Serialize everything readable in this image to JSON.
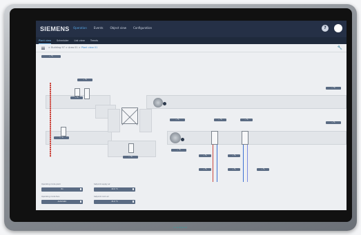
{
  "app": {
    "brand": "SIEMENS",
    "nav": [
      {
        "label": "Operation",
        "active": true
      },
      {
        "label": "Events"
      },
      {
        "label": "Object view"
      },
      {
        "label": "Configuration"
      }
    ],
    "help_glyph": "?",
    "device_brand": "SIEMENS"
  },
  "subtabs": [
    {
      "label": "Plant view",
      "active": true
    },
    {
      "label": "Scheduler"
    },
    {
      "label": "List view"
    },
    {
      "label": "Trends"
    }
  ],
  "breadcrumb": {
    "items": [
      "Building 97",
      "Area 01",
      "Plant view 01"
    ],
    "separator": ">"
  },
  "plant": {
    "tags": [
      {
        "label": "-- °C"
      },
      {
        "label": "-- °C"
      },
      {
        "label": "-- %"
      },
      {
        "label": "-- °C"
      },
      {
        "label": "-- °C"
      },
      {
        "label": "-- %"
      },
      {
        "label": "-- °C"
      },
      {
        "label": "-- °C"
      },
      {
        "label": "-- %"
      },
      {
        "label": "-- %"
      },
      {
        "label": "-- %"
      },
      {
        "label": "-- %"
      },
      {
        "label": "-- %"
      },
      {
        "label": "-- %"
      },
      {
        "label": "-- °C"
      },
      {
        "label": "-- %"
      }
    ]
  },
  "tiles": [
    {
      "title": "Operating mode plant",
      "value": "On"
    },
    {
      "title": "Setpoint supply air",
      "value": "22.0 °C"
    },
    {
      "title": "Operating mode fans",
      "value": "Automatic"
    },
    {
      "title": "Setpoint room air",
      "value": "21.0 °C"
    }
  ],
  "colors": {
    "topbar": "#253046",
    "accent": "#56a7e6",
    "tag": "#5a6b83",
    "hot_pipe": "#c8463f",
    "cold_pipe": "#3b6fd1"
  }
}
